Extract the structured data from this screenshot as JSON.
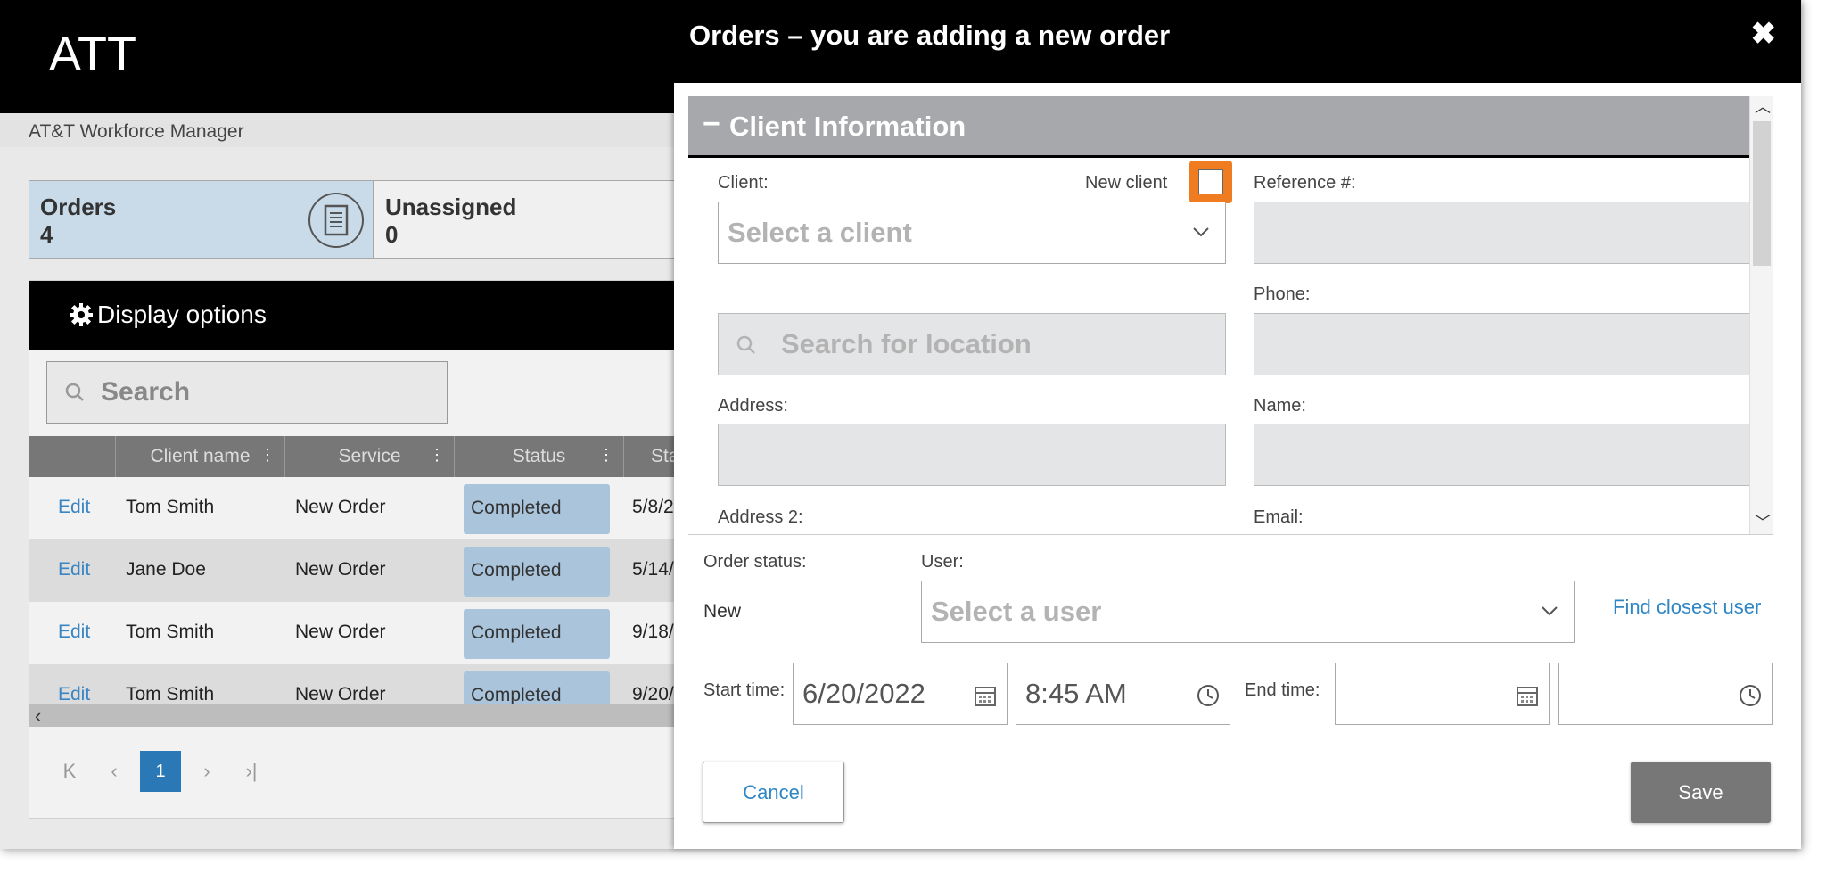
{
  "app": {
    "logo": "ATT",
    "subtitle": "AT&T Workforce Manager"
  },
  "stats": [
    {
      "label": "Orders",
      "count": "4"
    },
    {
      "label": "Unassigned",
      "count": "0"
    }
  ],
  "grid": {
    "display_options": "Display options",
    "search_placeholder": "Search",
    "columns": [
      "Client name",
      "Service",
      "Status",
      "Sta"
    ],
    "rows": [
      {
        "edit": "Edit",
        "client": "Tom Smith",
        "service": "New Order",
        "status": "Completed",
        "date": "5/8/2"
      },
      {
        "edit": "Edit",
        "client": "Jane Doe",
        "service": "New Order",
        "status": "Completed",
        "date": "5/14/"
      },
      {
        "edit": "Edit",
        "client": "Tom Smith",
        "service": "New Order",
        "status": "Completed",
        "date": "9/18/"
      },
      {
        "edit": "Edit",
        "client": "Tom Smith",
        "service": "New Order",
        "status": "Completed",
        "date": "9/20/"
      }
    ],
    "pager": {
      "first": "K",
      "prev": "‹",
      "current": "1",
      "next": "›",
      "last": "›|"
    }
  },
  "modal": {
    "title": "Orders – you are adding a new order",
    "close": "✖",
    "section_title": "Client Information",
    "section_toggle": "−",
    "client_label": "Client:",
    "new_client_label": "New client",
    "client_placeholder": "Select a client",
    "location_placeholder": "Search for location",
    "address_label": "Address:",
    "address2_label": "Address 2:",
    "reference_label": "Reference #:",
    "phone_label": "Phone:",
    "name_label": "Name:",
    "email_label": "Email:",
    "order_status_label": "Order status:",
    "order_status_value": "New",
    "user_label": "User:",
    "user_placeholder": "Select a user",
    "find_closest_user": "Find closest user",
    "start_time_label": "Start time:",
    "start_date": "6/20/2022",
    "start_time": "8:45 AM",
    "end_time_label": "End time:",
    "cancel": "Cancel",
    "save": "Save"
  },
  "colors": {
    "accent": "#2f86c4",
    "highlight": "#f07c21",
    "header": "#000000",
    "section": "#a7a8ab",
    "status_badge": "#a9c4db"
  }
}
